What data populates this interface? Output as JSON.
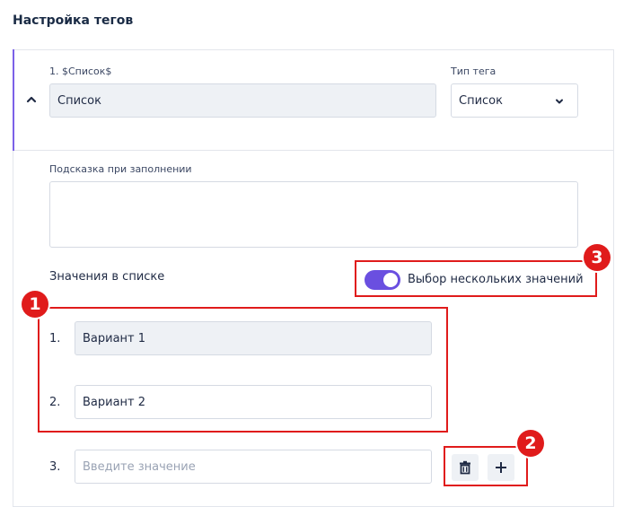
{
  "section_title": "Настройка тегов",
  "tag": {
    "header_label": "1. $Список$",
    "name_value": "Список",
    "type_label": "Тип тега",
    "type_value": "Список",
    "hint_label": "Подсказка при заполнении",
    "hint_value": ""
  },
  "values_section": {
    "label": "Значения в списке",
    "multi_select": {
      "label": "Выбор нескольких значений",
      "enabled": true
    },
    "items": [
      {
        "num": "1.",
        "value": "Вариант 1"
      },
      {
        "num": "2.",
        "value": "Вариант 2"
      },
      {
        "num": "3.",
        "value": "",
        "placeholder": "Введите значение"
      }
    ]
  },
  "annotations": [
    "1",
    "2",
    "3"
  ],
  "colors": {
    "accent": "#6a4fe0",
    "annotation_red": "#e01b1b",
    "title": "#1a2b45"
  },
  "icons": [
    "chevron-up-icon",
    "chevron-down-icon",
    "trash-icon",
    "plus-icon"
  ]
}
